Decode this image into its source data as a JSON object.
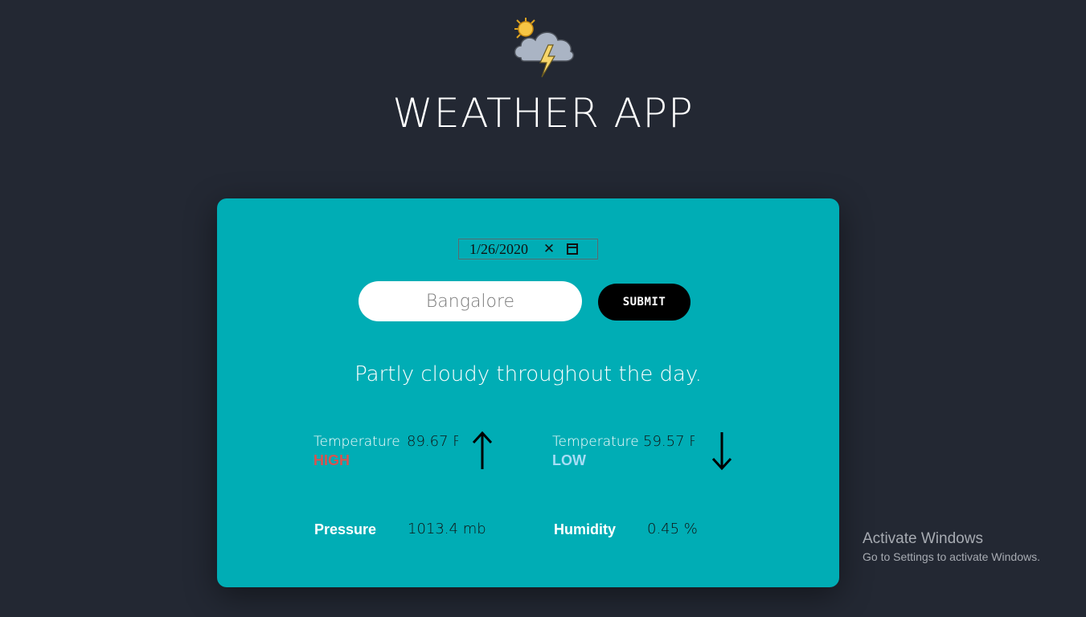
{
  "header": {
    "title": "WEATHER APP",
    "logo_icon": "sun-cloud-lightning-icon"
  },
  "form": {
    "date_value": "1/26/2020",
    "date_clear_icon": "close-icon",
    "date_picker_icon": "calendar-icon",
    "city_value": "",
    "city_placeholder": "Bangalore",
    "submit_label": "SUBMIT"
  },
  "weather": {
    "summary": "Partly cloudy throughout the day.",
    "high": {
      "label": "Temperature",
      "value": "89.67 F",
      "tag": "HIGH",
      "icon": "arrow-up-icon"
    },
    "low": {
      "label": "Temperature",
      "value": "59.57 F",
      "tag": "LOW",
      "icon": "arrow-down-icon"
    },
    "pressure": {
      "label": "Pressure",
      "value": "1013.4 mb"
    },
    "humidity": {
      "label": "Humidity",
      "value": "0.45 %"
    }
  },
  "watermark": {
    "title": "Activate Windows",
    "subtitle": "Go to Settings to activate Windows."
  },
  "colors": {
    "background": "#232833",
    "card": "#00adb5",
    "high_tag": "#d9534f",
    "low_tag": "#a7ddf5",
    "button": "#000000"
  }
}
